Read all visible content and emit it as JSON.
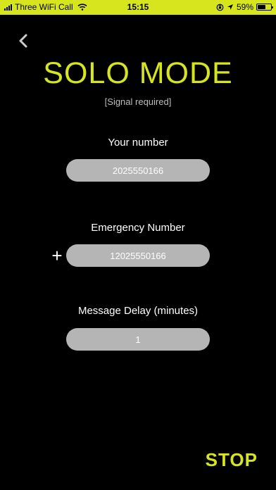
{
  "status_bar": {
    "carrier": "Three WiFi Call",
    "time": "15:15",
    "battery_percent": "59%",
    "battery_level": 0.59,
    "icons": [
      "signal-icon",
      "wifi-icon",
      "orientation-lock-icon",
      "location-arrow-icon",
      "battery-icon"
    ],
    "background_color": "#d7e51f"
  },
  "header": {
    "back_icon": "chevron-left-icon",
    "title": "SOLO MODE",
    "subtitle": "[Signal required]"
  },
  "form": {
    "your_number": {
      "label": "Your number",
      "value": "2025550166"
    },
    "emergency_number": {
      "label": "Emergency Number",
      "value": "12025550166",
      "add_label": "+"
    },
    "message_delay": {
      "label": "Message Delay (minutes)",
      "value": "1"
    }
  },
  "actions": {
    "stop_label": "STOP"
  },
  "colors": {
    "accent": "#d7e51f",
    "background": "#000000",
    "field": "#b5b5b5"
  }
}
